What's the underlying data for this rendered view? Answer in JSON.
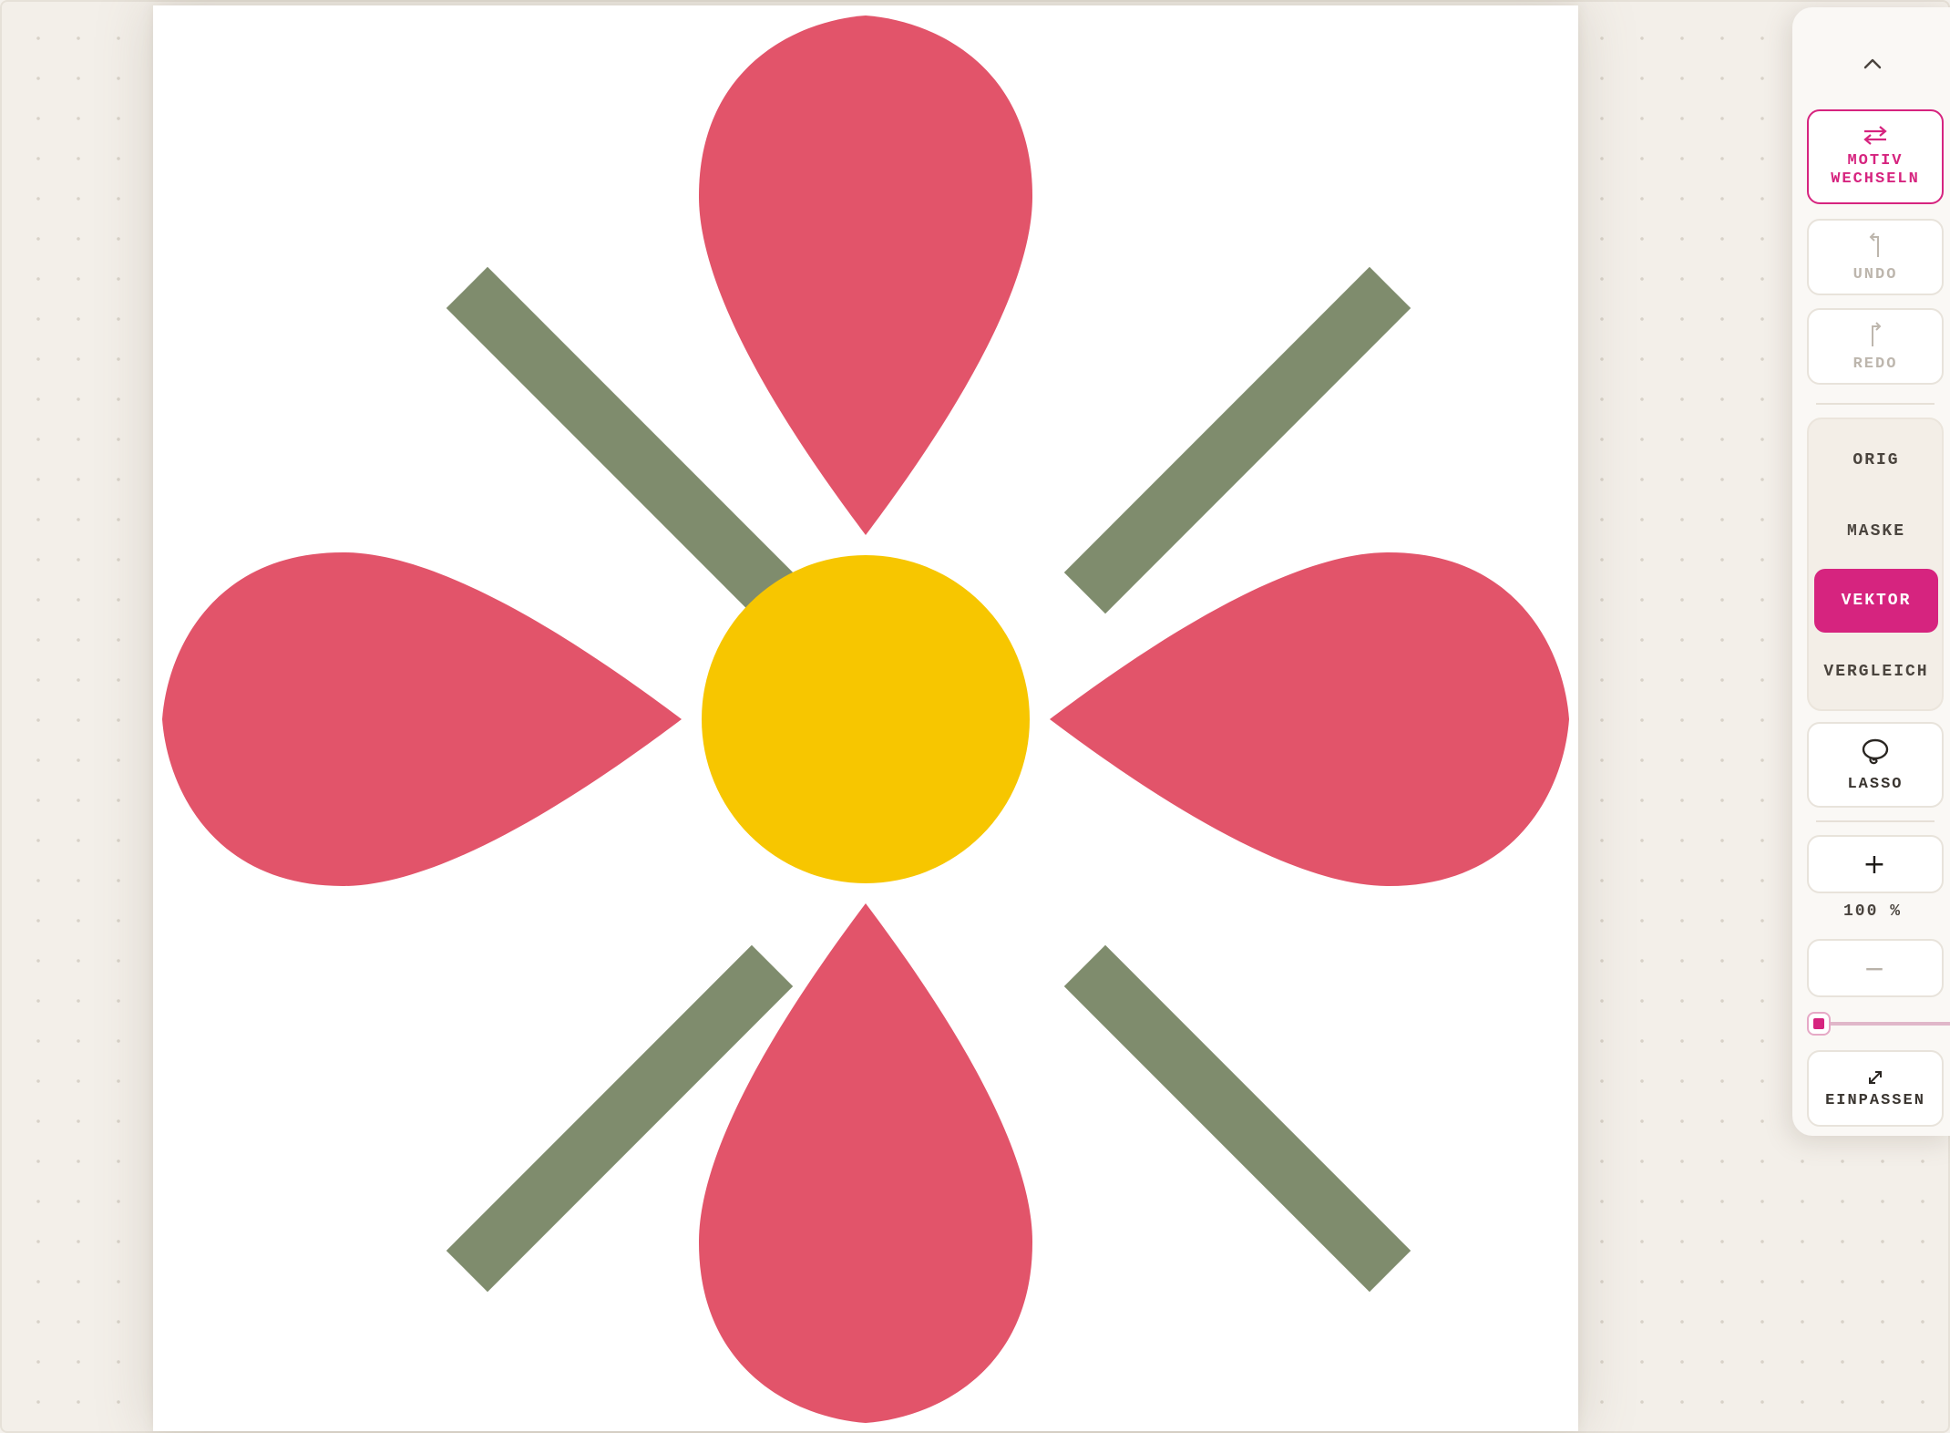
{
  "toolbar": {
    "collapse_icon": "chevron-up-icon",
    "motiv_label": "MOTIV WECHSELN",
    "motiv_icon": "swap-arrows-icon",
    "undo_label": "UNDO",
    "undo_icon": "undo-arrow-icon",
    "redo_label": "REDO",
    "redo_icon": "redo-arrow-icon",
    "view_options": [
      "ORIG",
      "MASKE",
      "VEKTOR",
      "VERGLEICH"
    ],
    "active_view": "VEKTOR",
    "lasso_label": "LASSO",
    "lasso_icon": "lasso-icon",
    "zoom_in_label": "+",
    "zoom_level": "100 %",
    "zoom_out_label": "−",
    "zoom_slider_fraction": 0.0,
    "fit_label": "EINPASSEN",
    "fit_icon": "expand-arrows-icon"
  },
  "canvas": {
    "motif": "flower",
    "colors": {
      "petal": "#e2546a",
      "center": "#f7c600",
      "stem": "#7f8c6d",
      "background": "#ffffff"
    }
  },
  "theme": {
    "accent": "#d6247f",
    "workspace": "#f3efe9"
  }
}
